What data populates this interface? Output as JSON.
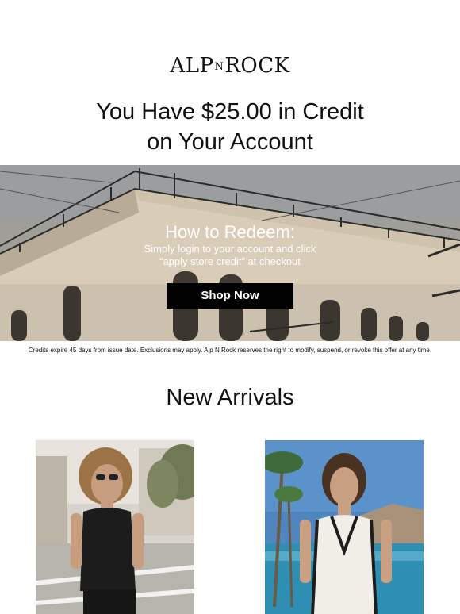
{
  "brand": {
    "logo_left": "ALP",
    "logo_mid": "N",
    "logo_right": "ROCK"
  },
  "headline": {
    "line1": "You Have $25.00 in Credit",
    "line2": "on Your Account"
  },
  "hero": {
    "title": "How to Redeem:",
    "body_line1": "Simply login to your account and click",
    "body_line2": "“apply store credit” at checkout",
    "cta_label": "Shop Now"
  },
  "disclaimer": "Credits expire 45 days from issue date. Exclusions may apply. Alp N Rock reserves the right to modify, suspend, or revoke this offer at any time.",
  "arrivals": {
    "title": "New Arrivals"
  },
  "colors": {
    "cta_bg": "#000000",
    "cta_text": "#ffffff",
    "hero_sky": "#a3a19c",
    "pool": "#2f8fb3"
  }
}
